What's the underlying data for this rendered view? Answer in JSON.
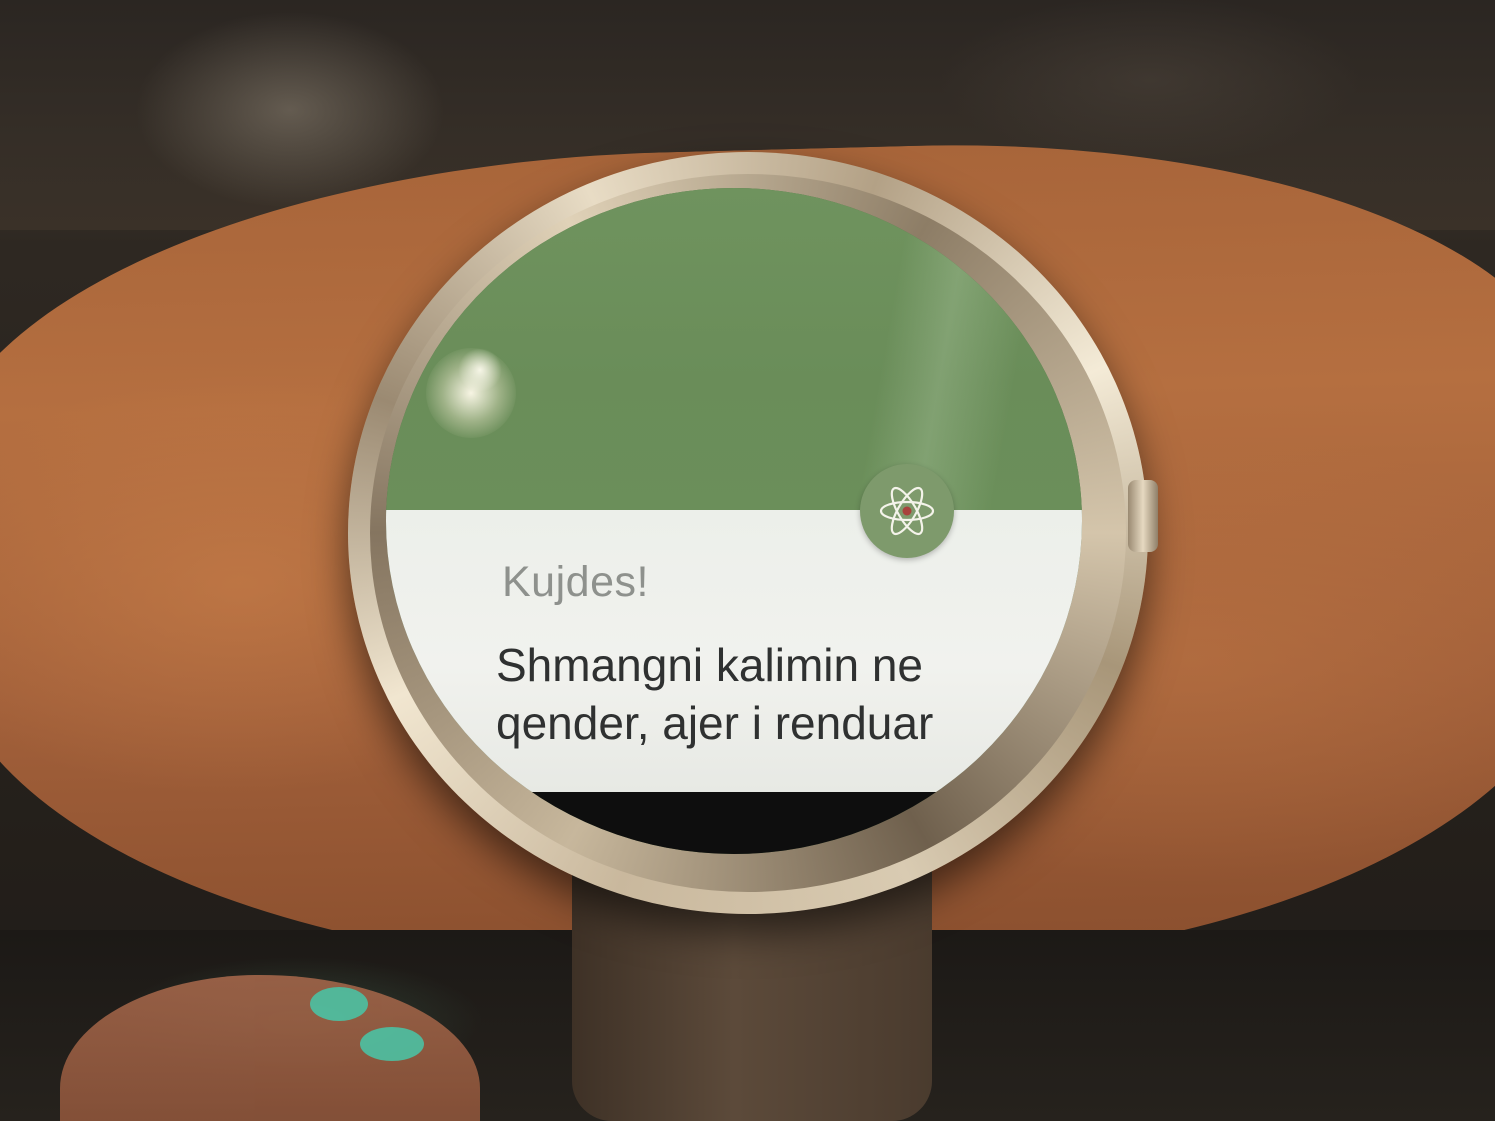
{
  "notification": {
    "title": "Kujdes!",
    "message": "Shmangni kalimin ne qender, ajer i renduar",
    "icon": "atom-icon"
  },
  "colors": {
    "header_green": "#6b8f5a",
    "icon_green": "#7e9a6c",
    "card_background": "#f1f2ee",
    "title_text": "#8e918d",
    "body_text": "#2f3131"
  }
}
